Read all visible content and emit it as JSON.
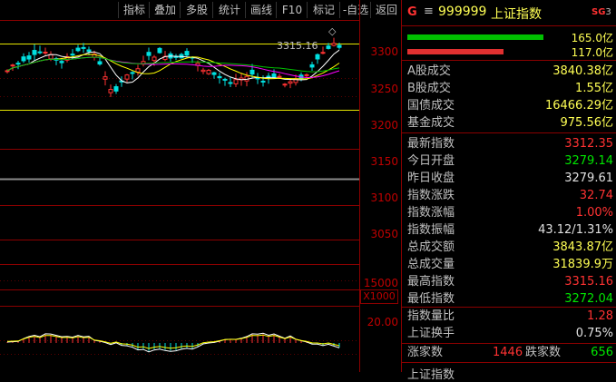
{
  "toolbar": [
    "指标",
    "叠加",
    "多股",
    "统计",
    "画线",
    "F10",
    "标记",
    "-自选",
    "返回"
  ],
  "chart": {
    "high_label": "3315.16",
    "diamond": "◇",
    "price_ticks": [
      "3300",
      "3250",
      "3200",
      "3150",
      "3100",
      "3050"
    ],
    "vol_tick": "15000",
    "vol_unit": "X1000",
    "osc_tick": "20.00"
  },
  "header": {
    "g_icon": "G",
    "menu_icon": "≡",
    "code": "999999",
    "name": "上证指数",
    "badge": "SG",
    "badge_num": "3"
  },
  "bars": {
    "up_value": "165.0亿",
    "down_value": "117.0亿",
    "up_ratio": 0.585,
    "down_ratio": 0.415
  },
  "turnover": [
    {
      "label": "A股成交",
      "value": "3840.38亿"
    },
    {
      "label": "B股成交",
      "value": "1.55亿"
    },
    {
      "label": "国债成交",
      "value": "16466.29亿"
    },
    {
      "label": "基金成交",
      "value": "975.56亿"
    }
  ],
  "stats": [
    {
      "label": "最新指数",
      "value": "3312.35",
      "color": "#ff3232"
    },
    {
      "label": "今日开盘",
      "value": "3279.14",
      "color": "#00e600"
    },
    {
      "label": "昨日收盘",
      "value": "3279.61",
      "color": "#e0e0e0"
    },
    {
      "label": "指数涨跌",
      "value": "32.74",
      "color": "#ff3232"
    },
    {
      "label": "指数涨幅",
      "value": "1.00%",
      "color": "#ff3232"
    },
    {
      "label": "指数振幅",
      "value": "43.12/1.31%",
      "color": "#e0e0e0"
    },
    {
      "label": "总成交额",
      "value": "3843.87亿",
      "color": "#ffff54"
    },
    {
      "label": "总成交量",
      "value": "31839.9万",
      "color": "#ffff54"
    },
    {
      "label": "最高指数",
      "value": "3315.16",
      "color": "#ff3232"
    },
    {
      "label": "最低指数",
      "value": "3272.04",
      "color": "#00e600"
    }
  ],
  "ratio": [
    {
      "label": "指数量比",
      "value": "1.28",
      "color": "#ff3232"
    },
    {
      "label": "上证换手",
      "value": "0.75%",
      "color": "#e0e0e0"
    }
  ],
  "breadth": {
    "up_label": "涨家数",
    "up_value": "1446",
    "down_label": "跌家数",
    "down_value": "656"
  },
  "footer_partial": "上证指数"
}
